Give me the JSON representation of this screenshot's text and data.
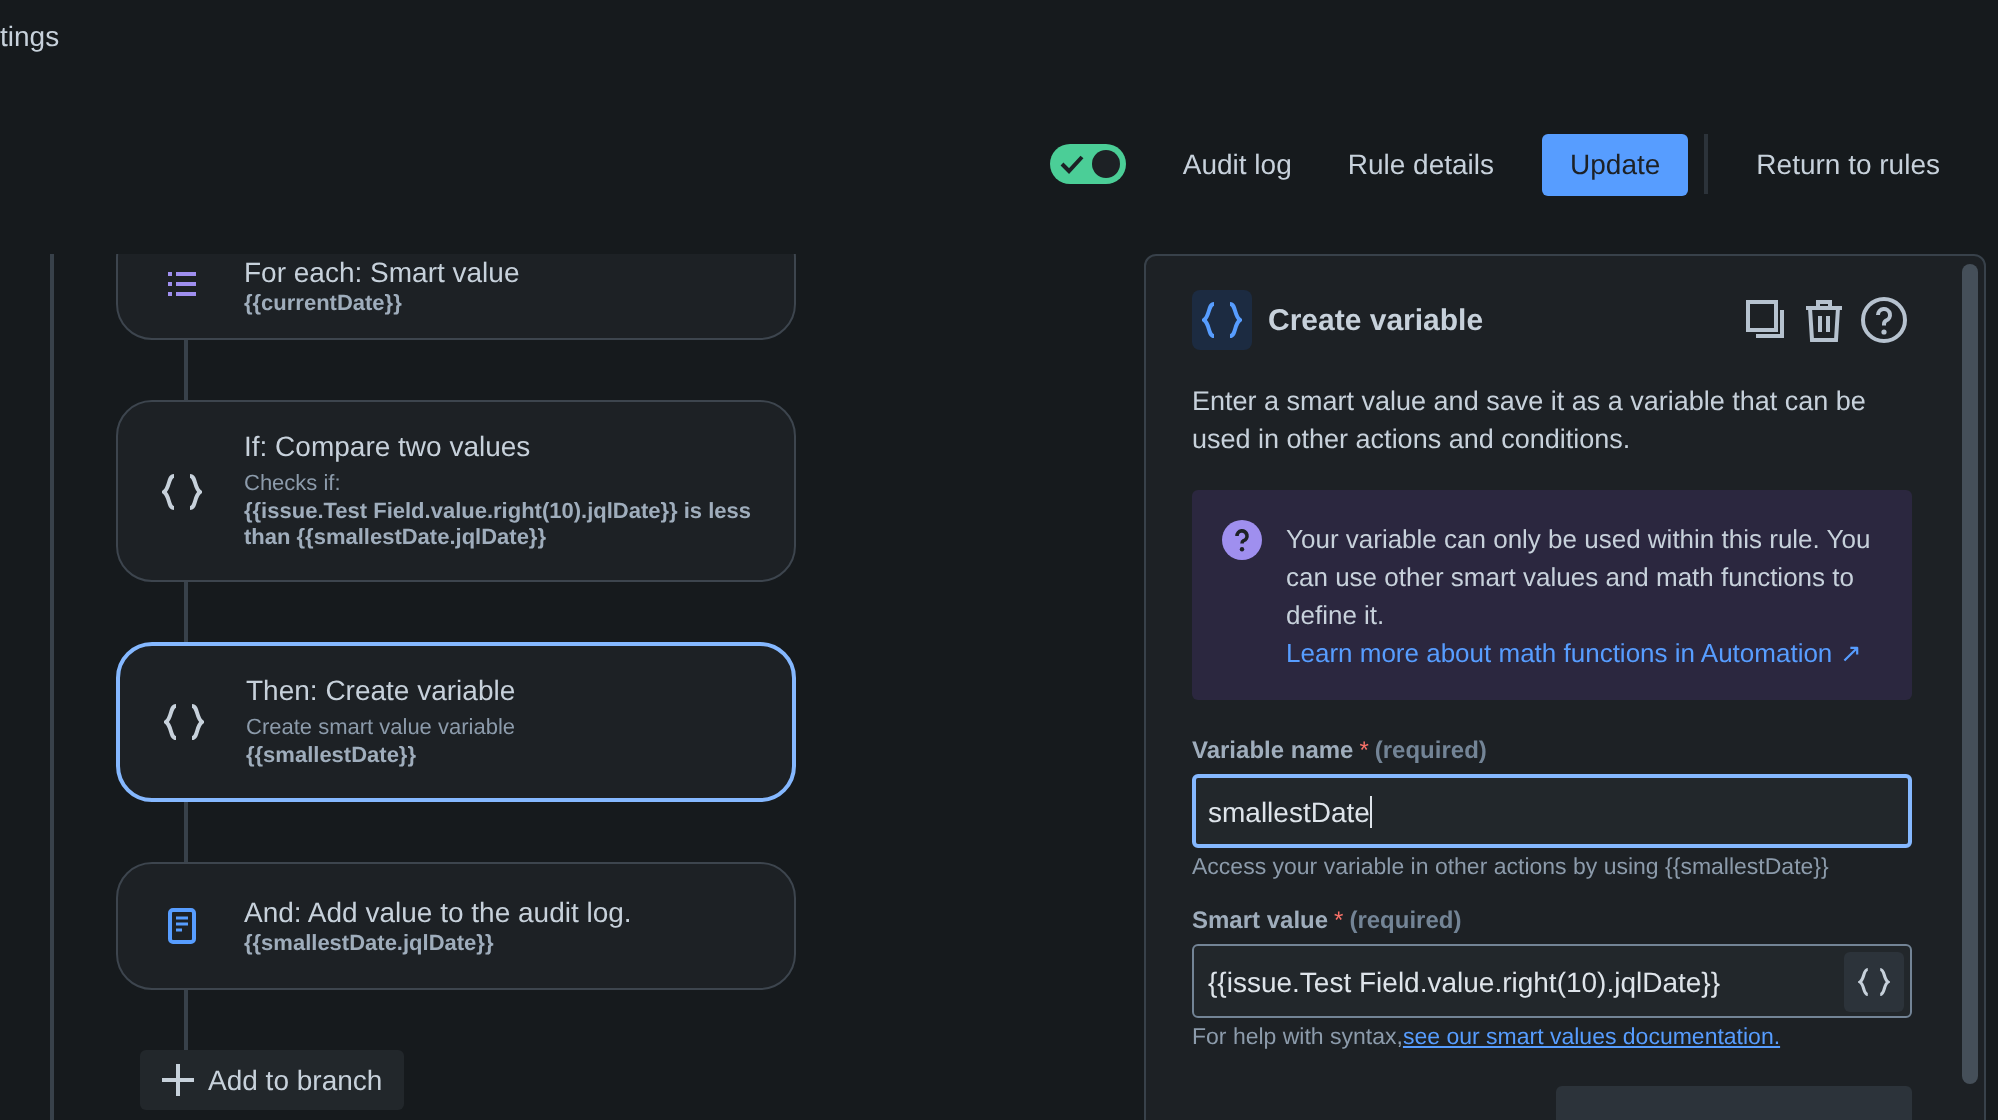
{
  "breadcrumb": "tings",
  "header": {
    "toggle": {
      "on": true
    },
    "links": [
      "Audit log",
      "Rule details"
    ],
    "primary": "Update",
    "return": "Return to rules"
  },
  "flow": {
    "steps": [
      {
        "kind": "loop",
        "title": "For each: Smart value",
        "detail": "{{currentDate}}",
        "selected": false
      },
      {
        "kind": "condition",
        "title": "If: Compare two values",
        "subtitle": "Checks if:",
        "detail": "{{issue.Test Field.value.right(10).jqlDate}} is less than {{smallestDate.jqlDate}}",
        "selected": false
      },
      {
        "kind": "variable",
        "title": "Then: Create variable",
        "subtitle": "Create smart value variable",
        "detail": "{{smallestDate}}",
        "selected": true
      },
      {
        "kind": "log",
        "title": "And: Add value to the audit log.",
        "detail": "{{smallestDate.jqlDate}}",
        "selected": false
      }
    ],
    "add_button": "Add to branch"
  },
  "panel": {
    "title": "Create variable",
    "description": "Enter a smart value and save it as a variable that can be used in other actions and conditions.",
    "info": {
      "text": "Your variable can only be used within this rule. You can use other smart values and math functions to define it.",
      "link": "Learn more about math functions in Automation ↗"
    },
    "fields": [
      {
        "kind": "text",
        "label": "Variable name",
        "required_mark": "*",
        "hint": "(required)",
        "value": "smallestDate",
        "focused": true,
        "help": "Access your variable in other actions by using {{smallestDate}}"
      },
      {
        "kind": "smart",
        "label": "Smart value",
        "required_mark": "*",
        "hint": "(required)",
        "value": "{{issue.Test Field.value.right(10).jqlDate}}",
        "focused": false,
        "help": "For help with syntax,",
        "help_link": "see our smart values documentation."
      }
    ]
  }
}
